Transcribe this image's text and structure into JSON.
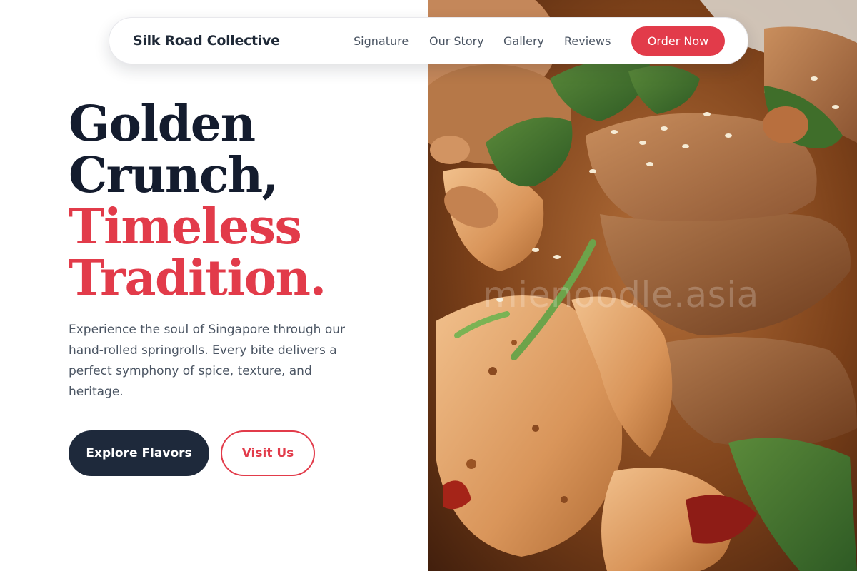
{
  "nav": {
    "brand": "Silk Road Collective",
    "links": [
      {
        "label": "Signature"
      },
      {
        "label": "Our Story"
      },
      {
        "label": "Gallery"
      },
      {
        "label": "Reviews"
      }
    ],
    "cta_label": "Order Now"
  },
  "hero": {
    "headline_lines": [
      "Golden",
      "Crunch,",
      "Timeless",
      "Tradition."
    ],
    "description": "Experience the soul of Singapore through our hand-rolled springrolls. Every bite delivers a perfect symphony of spice, texture, and heritage.",
    "primary_cta": "Explore Flavors",
    "secondary_cta": "Visit Us",
    "image_watermark": "mienoodle.asia"
  },
  "colors": {
    "accent": "#e23b4a",
    "dark": "#1e293b",
    "headline_dark": "#141c2e",
    "body_text": "#4b5563",
    "background": "#ffffff"
  },
  "icons": []
}
